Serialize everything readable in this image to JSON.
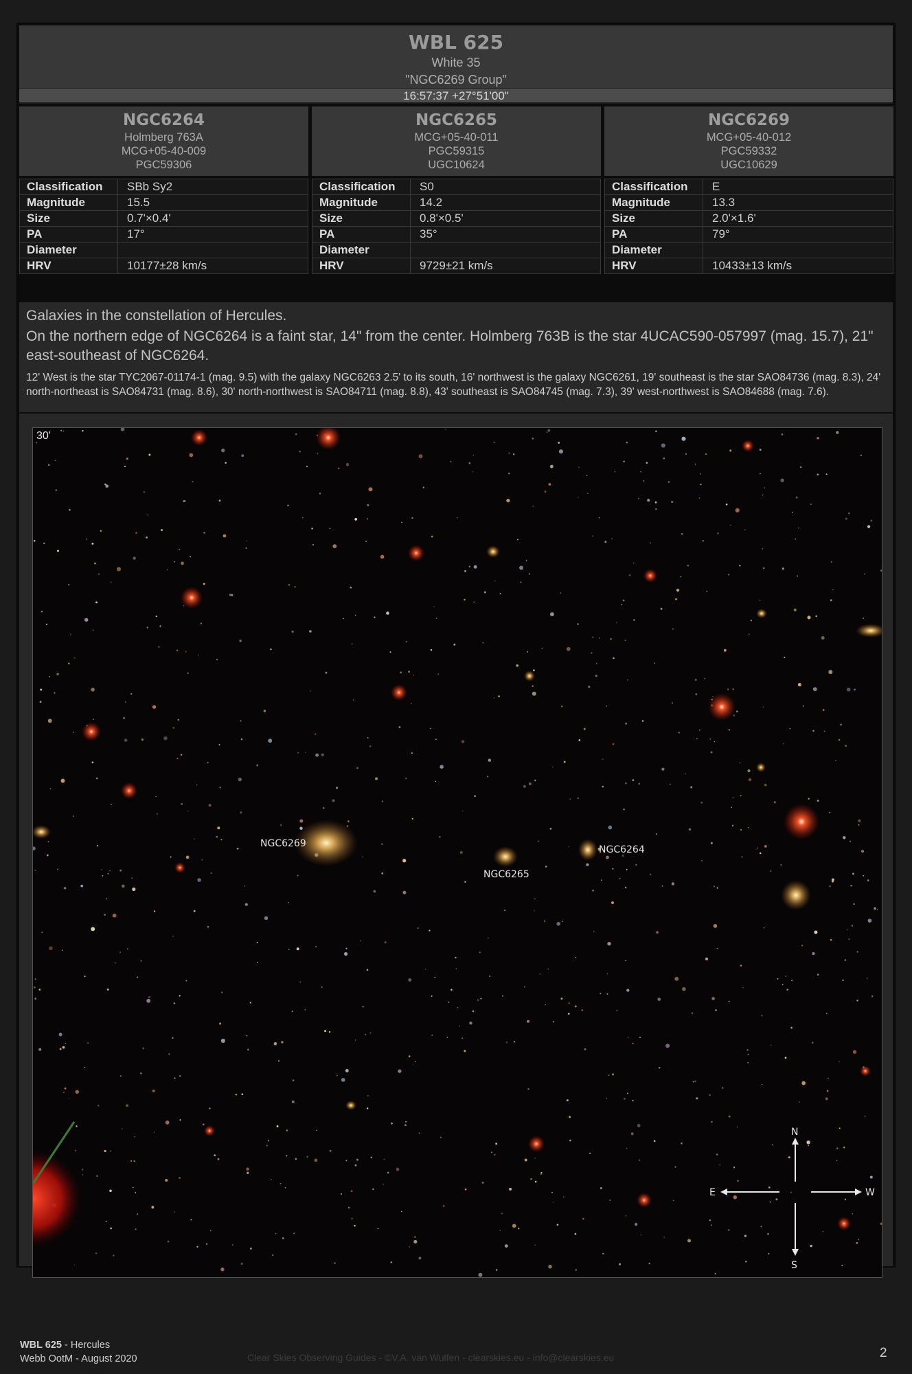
{
  "header": {
    "title": "WBL 625",
    "subtitle": "White 35",
    "alt_name": "\"NGC6269 Group\"",
    "coordinates": "16:57:37 +27°51'00\""
  },
  "galaxies": [
    {
      "name": "NGC6264",
      "ids": [
        "Holmberg 763A",
        "MCG+05-40-009",
        "PGC59306"
      ],
      "props": [
        {
          "label": "Classification",
          "value": "SBb Sy2"
        },
        {
          "label": "Magnitude",
          "value": "15.5"
        },
        {
          "label": "Size",
          "value": "0.7'×0.4'"
        },
        {
          "label": "PA",
          "value": "17°"
        },
        {
          "label": "Diameter",
          "value": ""
        },
        {
          "label": "HRV",
          "value": "10177±28 km/s"
        }
      ]
    },
    {
      "name": "NGC6265",
      "ids": [
        "MCG+05-40-011",
        "PGC59315",
        "UGC10624"
      ],
      "props": [
        {
          "label": "Classification",
          "value": "S0"
        },
        {
          "label": "Magnitude",
          "value": "14.2"
        },
        {
          "label": "Size",
          "value": "0.8'×0.5'"
        },
        {
          "label": "PA",
          "value": "35°"
        },
        {
          "label": "Diameter",
          "value": ""
        },
        {
          "label": "HRV",
          "value": "9729±21 km/s"
        }
      ]
    },
    {
      "name": "NGC6269",
      "ids": [
        "MCG+05-40-012",
        "PGC59332",
        "UGC10629"
      ],
      "props": [
        {
          "label": "Classification",
          "value": "E"
        },
        {
          "label": "Magnitude",
          "value": "13.3"
        },
        {
          "label": "Size",
          "value": "2.0'×1.6'"
        },
        {
          "label": "PA",
          "value": "79°"
        },
        {
          "label": "Diameter",
          "value": ""
        },
        {
          "label": "HRV",
          "value": "10433±13 km/s"
        }
      ]
    }
  ],
  "notes": {
    "constellation": "Galaxies in the constellation of Hercules.",
    "note1": "On the northern edge of NGC6264 is a faint star, 14\" from the center. Holmberg 763B is the star 4UCAC590-057997 (mag. 15.7), 21\" east-southeast of NGC6264.",
    "note2": "12' West is the star TYC2067-01174-1 (mag. 9.5) with the galaxy NGC6263 2.5' to its south, 16' northwest is the galaxy NGC6261, 19' southeast is the star SAO84736 (mag. 8.3), 24' north-northeast is SAO84731 (mag. 8.6), 30' north-northwest is SAO84711 (mag. 8.8), 43' southeast is SAO84745 (mag. 7.3), 39' west-northwest is SAO84688 (mag. 7.6)."
  },
  "image": {
    "scale_label": "30'",
    "labels": {
      "g1": "NGC6269",
      "g2": "NGC6265",
      "g3": "NGC6264"
    },
    "compass": {
      "n": "N",
      "s": "S",
      "e": "E",
      "w": "W"
    }
  },
  "footer": {
    "object": "WBL 625",
    "constellation": " - Hercules",
    "guide": "Webb OotM - August 2020",
    "credit": "Clear Skies Observing Guides - ©V.A. van Wulfen - clearskies.eu - info@clearskies.eu",
    "page": "2"
  }
}
